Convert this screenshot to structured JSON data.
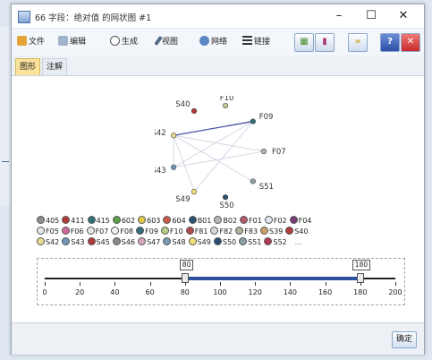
{
  "window": {
    "title": "66 字段：绝对值 的网状图 #1"
  },
  "window_controls": {
    "minimize": "–",
    "maximize": "☐",
    "close": "✕"
  },
  "toolbar": {
    "file": "文件",
    "edit": "编辑",
    "generate": "生成",
    "view": "视图",
    "network": "网络",
    "links": "链接",
    "next": "»",
    "help": "?",
    "close": "✕"
  },
  "tabs": [
    {
      "label": "图形",
      "active": true
    },
    {
      "label": "注解",
      "active": false
    }
  ],
  "graph": {
    "nodes": [
      {
        "label": "F10",
        "color": "#b9ce8a"
      },
      {
        "label": "F09",
        "color": "#2f6f7a"
      },
      {
        "label": "F07",
        "color": "#b6b6b6"
      },
      {
        "label": "S51",
        "color": "#8aa0a6"
      },
      {
        "label": "S50",
        "color": "#2b4f72"
      },
      {
        "label": "S49",
        "color": "#f0e07a"
      },
      {
        "label": "S43",
        "color": "#7396b8"
      },
      {
        "label": "S42",
        "color": "#e9dc8e"
      },
      {
        "label": "S40",
        "color": "#b13a3a"
      }
    ],
    "links": [
      {
        "from": "S42",
        "to": "F09",
        "strength": "strong"
      },
      {
        "from": "S42",
        "to": "F07",
        "strength": "weak"
      },
      {
        "from": "S42",
        "to": "S43",
        "strength": "weak"
      },
      {
        "from": "S42",
        "to": "S51",
        "strength": "weak"
      },
      {
        "from": "F09",
        "to": "S43",
        "strength": "weak"
      },
      {
        "from": "F09",
        "to": "S49",
        "strength": "weak"
      },
      {
        "from": "S43",
        "to": "F07",
        "strength": "weak"
      },
      {
        "from": "S42",
        "to": "S49",
        "strength": "weak"
      }
    ]
  },
  "legend": {
    "rows": [
      [
        {
          "label": "405",
          "color": "#8d8d8d"
        },
        {
          "label": "411",
          "color": "#b13a3a"
        },
        {
          "label": "415",
          "color": "#2f6f7a"
        },
        {
          "label": "602",
          "color": "#5aa04a"
        },
        {
          "label": "603",
          "color": "#e3c94a"
        },
        {
          "label": "604",
          "color": "#c95b4a"
        },
        {
          "label": "B01",
          "color": "#2b4f72"
        },
        {
          "label": "B02",
          "color": "#b6b6b6"
        },
        {
          "label": "F01",
          "color": "#b25a6a"
        },
        {
          "label": "F02",
          "color": "#dde6f0"
        },
        {
          "label": "F04",
          "color": "#7a3d7a"
        }
      ],
      [
        {
          "label": "F05",
          "color": "#e6e6e6"
        },
        {
          "label": "F06",
          "color": "#d26a9a"
        },
        {
          "label": "F07",
          "color": "#e6e6e6"
        },
        {
          "label": "F08",
          "color": "#f2f2f2"
        },
        {
          "label": "F09",
          "color": "#2f6f7a"
        },
        {
          "label": "F10",
          "color": "#b9ce8a"
        },
        {
          "label": "F81",
          "color": "#b14a4a"
        },
        {
          "label": "F82",
          "color": "#d9d9d9"
        },
        {
          "label": "F83",
          "color": "#a9b29a"
        },
        {
          "label": "S39",
          "color": "#c9a06a"
        },
        {
          "label": "S40",
          "color": "#b13a3a"
        }
      ],
      [
        {
          "label": "S42",
          "color": "#e9dc8e"
        },
        {
          "label": "S43",
          "color": "#7396b8"
        },
        {
          "label": "S45",
          "color": "#b13a3a"
        },
        {
          "label": "S46",
          "color": "#8a8a8a"
        },
        {
          "label": "S47",
          "color": "#d9a6c0"
        },
        {
          "label": "S48",
          "color": "#7a9ab2"
        },
        {
          "label": "S49",
          "color": "#f0e07a"
        },
        {
          "label": "S50",
          "color": "#2b4f72"
        },
        {
          "label": "S51",
          "color": "#8aa0a6"
        },
        {
          "label": "S52",
          "color": "#b13a5a"
        }
      ]
    ],
    "more": "..."
  },
  "slider": {
    "min": 0,
    "max": 200,
    "low": 80,
    "high": 180,
    "low_label": "80",
    "high_label": "180",
    "ticks": [
      "0",
      "20",
      "40",
      "60",
      "80",
      "100",
      "120",
      "140",
      "160",
      "180",
      "200"
    ]
  },
  "footer": {
    "ok_label": "确定"
  }
}
